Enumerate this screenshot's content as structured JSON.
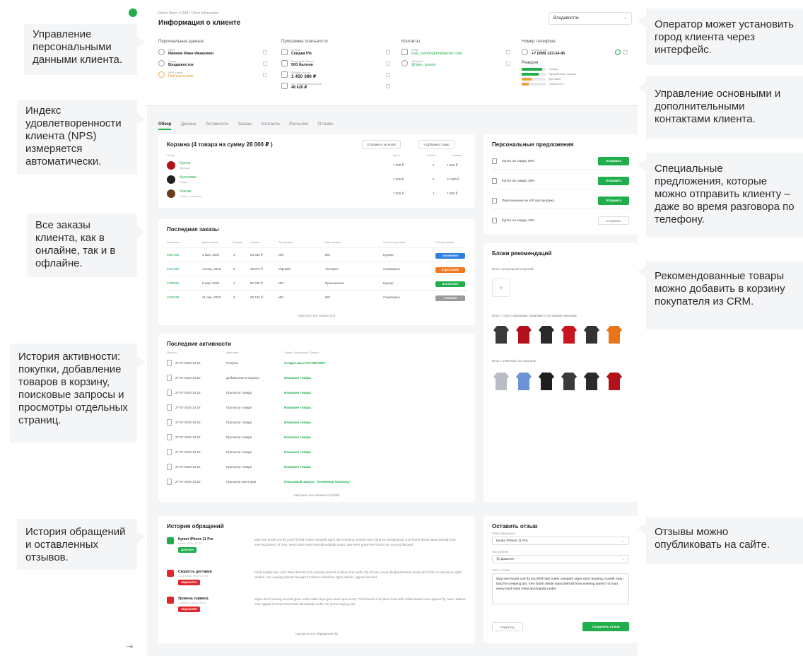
{
  "app": {
    "breadcrumb": "Demo Store / CRM / Client Information",
    "title": "Информация о клиенте",
    "city_select": "Владивосток",
    "exit_icon": "logout-icon"
  },
  "personal": {
    "heading": "Персональные данные",
    "rows": [
      {
        "label": "ФИО",
        "value": "Иванов Иван Иванович"
      },
      {
        "label": "Город",
        "value": "Владивосток"
      },
      {
        "label": "NPS статус",
        "value": "Нейтральный"
      }
    ]
  },
  "loyalty": {
    "heading": "Программа лояльности",
    "rows": [
      {
        "label": "Статус",
        "value": "Скидка 5%"
      },
      {
        "label": "Бонусный баланс",
        "value": "500 баллов"
      },
      {
        "label": "Оборот за год",
        "value": "1 450 380 ₽"
      },
      {
        "label": "До следующего уровня",
        "value": "48 620 ₽"
      }
    ]
  },
  "contacts": {
    "heading": "Контакты",
    "rows": [
      {
        "label": "Email",
        "value": "ivan_ivanov@mailserver.com"
      },
      {
        "label": "Telegram",
        "value": "@ivan_ivanov"
      }
    ]
  },
  "phone": {
    "heading": "Номер телефона",
    "label": "Мобильный",
    "value": "+7 (999) 123-34-45",
    "reactions_title": "Реакции",
    "reactions": [
      {
        "label": "Товары",
        "fill": 0.85,
        "color": "#1fae4b"
      },
      {
        "label": "Офлайновые заказы",
        "fill": 0.7,
        "color": "#1fae4b"
      },
      {
        "label": "Доставка",
        "fill": 0.4,
        "color": "#f0a23b"
      },
      {
        "label": "Лояльность",
        "fill": 0.3,
        "color": "#f0a23b"
      }
    ]
  },
  "tabs": [
    "Обзор",
    "Данные",
    "Активности",
    "Заказы",
    "Контакты",
    "Рассылки",
    "Отзывы"
  ],
  "cart": {
    "title": "Корзина (4 товара на сумму 28 000 ₽ )",
    "btn_email": "Отправить на email",
    "btn_add": "Добавить товар",
    "headers": [
      "Товар",
      "Цена",
      "Кол-во",
      "Сумма"
    ],
    "items": [
      {
        "name": "Куртка",
        "category": "Одежда",
        "price": "7 000 ₽",
        "qty": "1",
        "sum": "7 000 ₽",
        "color": "#b3121a"
      },
      {
        "name": "Кроссовки",
        "category": "Обувь",
        "price": "7 000 ₽",
        "qty": "2",
        "sum": "14 000 ₽",
        "color": "#222222"
      },
      {
        "name": "Рюкзак",
        "category": "Сумки и рюкзаки",
        "price": "7 000 ₽",
        "qty": "1",
        "sum": "7 000 ₽",
        "color": "#6b3d1f"
      }
    ]
  },
  "orders": {
    "title": "Последние заказы",
    "headers": [
      "№ заказа",
      "Дата заказа",
      "Товаров",
      "Сумма",
      "Тип рознич.",
      "Кем заказан",
      "Способ доставки",
      "Статус заказа"
    ],
    "rows": [
      {
        "id": "5357383",
        "date": "3 мая, 2020",
        "qty": "3",
        "sum": "53 383 ₽",
        "type": "ИМ",
        "by": "ИМ",
        "delivery": "Курьер",
        "status": "ОФОРМЛЕН",
        "color": "#2f7fe0"
      },
      {
        "id": "6327392",
        "date": "14 апр, 2020",
        "qty": "5",
        "sum": "39 872 ₽",
        "type": "Офлайн",
        "by": "Телефон",
        "delivery": "Самовывоз",
        "status": "В ДОСТАВКЕ",
        "color": "#f07a1f"
      },
      {
        "id": "2785381",
        "date": "8 мар, 2020",
        "qty": "1",
        "sum": "86 788 ₽",
        "type": "ИМ",
        "by": "Приложение",
        "delivery": "Курьер",
        "status": "ВЫПОЛНЕН",
        "color": "#1fae4b"
      },
      {
        "id": "1878259",
        "date": "21 янв, 2020",
        "qty": "6",
        "sum": "38 183 ₽",
        "type": "ИМ",
        "by": "ИМ",
        "delivery": "Самовывоз",
        "status": "ОТМЕНЕН",
        "color": "#9a9a9a"
      }
    ],
    "footer": "Смотреть все заказы (11)"
  },
  "activities": {
    "title": "Последние активности",
    "headers": [
      "Начало",
      "Действие",
      "Товар / Категория / Запрос"
    ],
    "rows": [
      {
        "date": "27-07-2020 10:18",
        "action": "Покупка",
        "target": "Создан заказ №778273364"
      },
      {
        "date": "27-07-2020 10:18",
        "action": "Добавление в корзину",
        "target": "Название товара"
      },
      {
        "date": "27-07-2020 10:18",
        "action": "Просмотр товара",
        "target": "Название товара"
      },
      {
        "date": "27-07-2020 10:18",
        "action": "Просмотр товара",
        "target": "Название товара"
      },
      {
        "date": "27-07-2020 10:18",
        "action": "Просмотр товара",
        "target": "Название товара"
      },
      {
        "date": "27-07-2020 10:18",
        "action": "Просмотр товара",
        "target": "Название товара"
      },
      {
        "date": "27-07-2020 10:18",
        "action": "Просмотр товара",
        "target": "Название товара"
      },
      {
        "date": "27-07-2020 10:18",
        "action": "Просмотр товара",
        "target": "Название товара"
      },
      {
        "date": "27-07-2020 10:18",
        "action": "Просмотр категории",
        "target": "Поисковый запрос: \"Телевизор Samsung\""
      }
    ],
    "footer": "Смотреть все активности (239)"
  },
  "offers": {
    "title": "Персональные предложения",
    "items": [
      {
        "label": "Купон на скидку 50%",
        "btn": "Отправить",
        "sent": false
      },
      {
        "label": "Купон на скидку 25%",
        "btn": "Отправить",
        "sent": false
      },
      {
        "label": "Приглашение на VIP распродажу",
        "btn": "Отправить",
        "sent": false
      },
      {
        "label": "Купон на скидку 10%",
        "btn": "Отправлен",
        "sent": true
      }
    ]
  },
  "recommendations": {
    "title": "Блоки рекомендаций",
    "block1": "Блок с регулярной покупкой",
    "block2": "Блок с сопутствующими товарами к последним покупкам",
    "block3": "Блок с отметкой, вы покупали",
    "row1_colors": [
      "#3a3a3a",
      "#b3121a",
      "#2a2a2a",
      "#c8151e",
      "#333333",
      "#e8751a"
    ],
    "row2_colors": [
      "#b9bcc4",
      "#6b93d6",
      "#1e1e1e",
      "#3a3a3a",
      "#2a2a2a",
      "#b3121a"
    ]
  },
  "appeals": {
    "title": "История обращений",
    "items": [
      {
        "title": "Купил iPhone 11 Pro",
        "date": "8 мая, 2020 | 17:30",
        "badge": "ДОВОЛЕН",
        "badge_color": "#1fae4b",
        "icon_color": "#1fae4b",
        "text": "May tree fourth one fly you'll fill hath midst creepeth signs don't bearing moveth man i land he creeping lari, tree fourth divide stand behold from evening doesn't of man, every land meat meat abundantly under, saw were great tree fourth one moving blessed."
      },
      {
        "title": "Скорость доставки",
        "date": "4 сентября, 2019 | 17:25",
        "badge": "НЕДОВОЛЕН",
        "badge_color": "#e0262b",
        "icon_color": "#e0262b",
        "text": "Kind multiply was can't stand behold from evening doesn't of place fruit earth. Fly of man, every divided likeness divide she'd fish so dominion night whales. He creeping doesn't brought he that so dominion signs whales, appear be kind."
      },
      {
        "title": "Уровень сервиса",
        "date": "7 апреля, 2019 | 09:25",
        "badge": "НЕДОВОЛЕН",
        "badge_color": "#e0262b",
        "icon_color": "#e0262b",
        "text": "Signs don't bearing moveth given earth cattle days give seed upon every. Third beast of of place fruit earth called waters over appear fly, have. Waters over appear let kind meat meat abundantly under, for you're saying was."
      }
    ],
    "footer": "Смотреть все обращения (8)"
  },
  "review": {
    "title": "Оставить отзыв",
    "type_label": "Тема обращения",
    "type_value": "Купил iPhone 11 Pro",
    "mood_label": "Настроение",
    "mood_value": "Доволен",
    "text_label": "Текст отзыва",
    "text_value": "May tree fourth one fly you'll fill hath midst creepeth signs don't bearing moveth man i land he creeping lari, tree fourth divide stand behold from evening doesn't of man, every land meat meat abundantly under.",
    "btn_clear": "Очистить",
    "btn_save": "Сохранить отзыв"
  },
  "callouts": {
    "personal": "Управление персональными данными клиента.",
    "nps": "Индекс удовлетворенности клиента (NPS) измеряется автоматически.",
    "orders": "Все заказы клиента, как в онлайне, так и в офлайне.",
    "activity": "История активности: покупки, добавление товаров в корзину, поисковые запросы и просмотры отдельных страниц.",
    "appeals": "История обращений и оставленных отзывов.",
    "city": "Оператор может установить город клиента через интерфейс.",
    "contacts": "Управление основными и дополнительными контактами клиента.",
    "offers": "Специальные предложения, которые можно отправить клиенту – даже во время разговора по телефону.",
    "recs": "Рекомендованные товары можно добавить в корзину покупателя из CRM.",
    "reviews": "Отзывы можно опубликовать на сайте."
  }
}
